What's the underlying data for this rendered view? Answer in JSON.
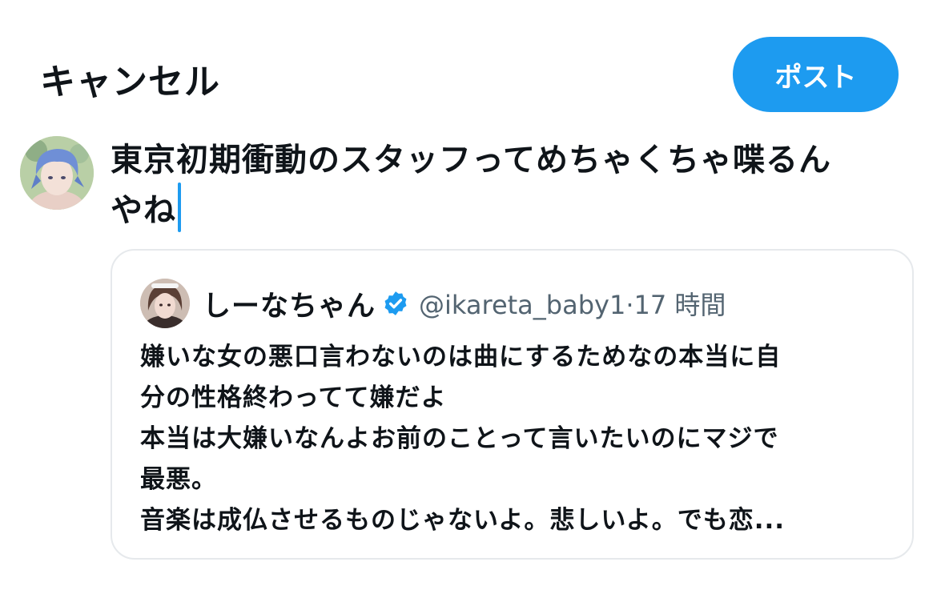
{
  "header": {
    "cancel_label": "キャンセル",
    "post_label": "ポスト"
  },
  "compose": {
    "lines": [
      "東京初期衝動のスタッフってめちゃくちゃ喋るん",
      "やね"
    ]
  },
  "quote": {
    "display_name": "しーなちゃん",
    "verified": true,
    "handle": "@ikareta_baby1",
    "separator": "·",
    "time": "17 時間",
    "body_lines": [
      "嫌いな女の悪口言わないのは曲にするためなの本当に自",
      "分の性格終わってて嫌だよ",
      "本当は大嫌いなんよお前のことって言いたいのにマジで",
      "最悪。",
      "音楽は成仏させるものじゃないよ。悲しいよ。でも恋..."
    ]
  },
  "colors": {
    "accent": "#1d9bf0",
    "text": "#0f1419",
    "secondary_text": "#536471",
    "border": "#e6e9ec"
  }
}
